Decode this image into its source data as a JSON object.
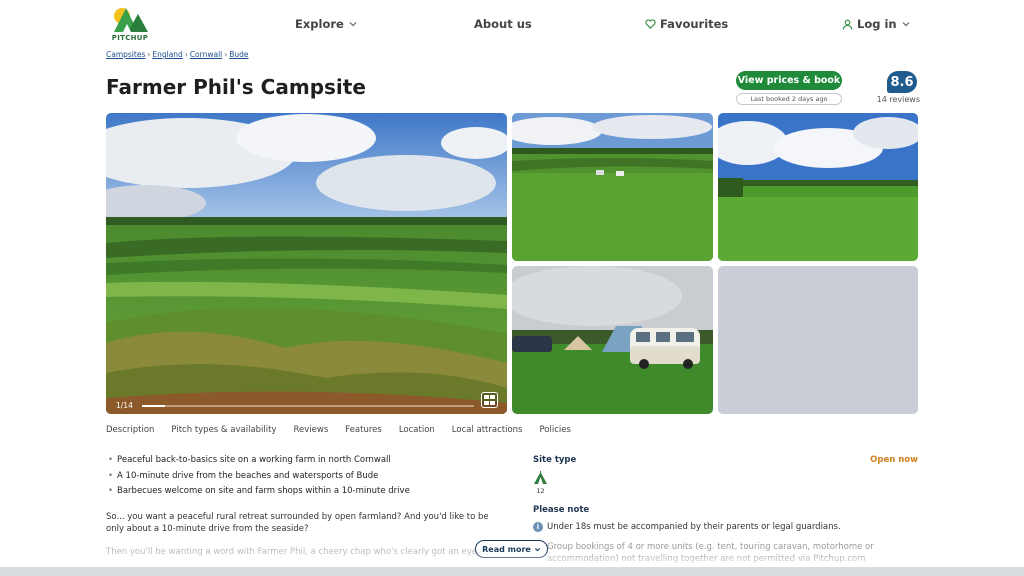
{
  "header": {
    "logo_text": "PITCHUP",
    "nav": [
      {
        "label": "Explore",
        "has_dropdown": true
      },
      {
        "label": "About us"
      },
      {
        "label": "Favourites",
        "icon": "heart-icon"
      },
      {
        "label": "Log in",
        "icon": "user-icon",
        "has_dropdown": true
      }
    ]
  },
  "breadcrumb": [
    "Campsites",
    "England",
    "Cornwall",
    "Bude"
  ],
  "title": "Farmer Phil's Campsite",
  "booking": {
    "button_label": "View prices & book",
    "last_booked": "Last booked 2 days ago"
  },
  "rating": {
    "score": "8.6",
    "reviews": "14 reviews"
  },
  "gallery": {
    "counter": "1/14",
    "progress": 0.07
  },
  "tabs": [
    "Description",
    "Pitch types & availability",
    "Reviews",
    "Features",
    "Location",
    "Local attractions",
    "Policies"
  ],
  "highlights": [
    "Peaceful back-to-basics site on a working farm in north Cornwall",
    "A 10-minute drive from the beaches and watersports of Bude",
    "Barbecues welcome on site and farm shops within a 10-minute drive"
  ],
  "description": {
    "paragraph": "So... you want a peaceful rural retreat surrounded by open farmland? And you'd like to be only about a 10-minute drive from the seaside?",
    "faded": "Then you'll be wanting a word with Farmer Phil, a cheery chap who's clearly got an eye",
    "read_more": "Read more"
  },
  "site_type": {
    "heading": "Site type",
    "status": "Open now",
    "tent_count": "12"
  },
  "notes": {
    "heading": "Please note",
    "items": [
      "Under 18s must be accompanied by their parents or legal guardians.",
      "Group bookings of 4 or more units (e.g. tent, touring caravan, motorhome or accommodation) not travelling together are not permitted via Pitchup.com"
    ]
  },
  "colors": {
    "brand_green": "#1f8a3a",
    "score_blue": "#1f5b8c",
    "open_orange": "#d2801f",
    "link_blue": "#1b4f8f"
  }
}
